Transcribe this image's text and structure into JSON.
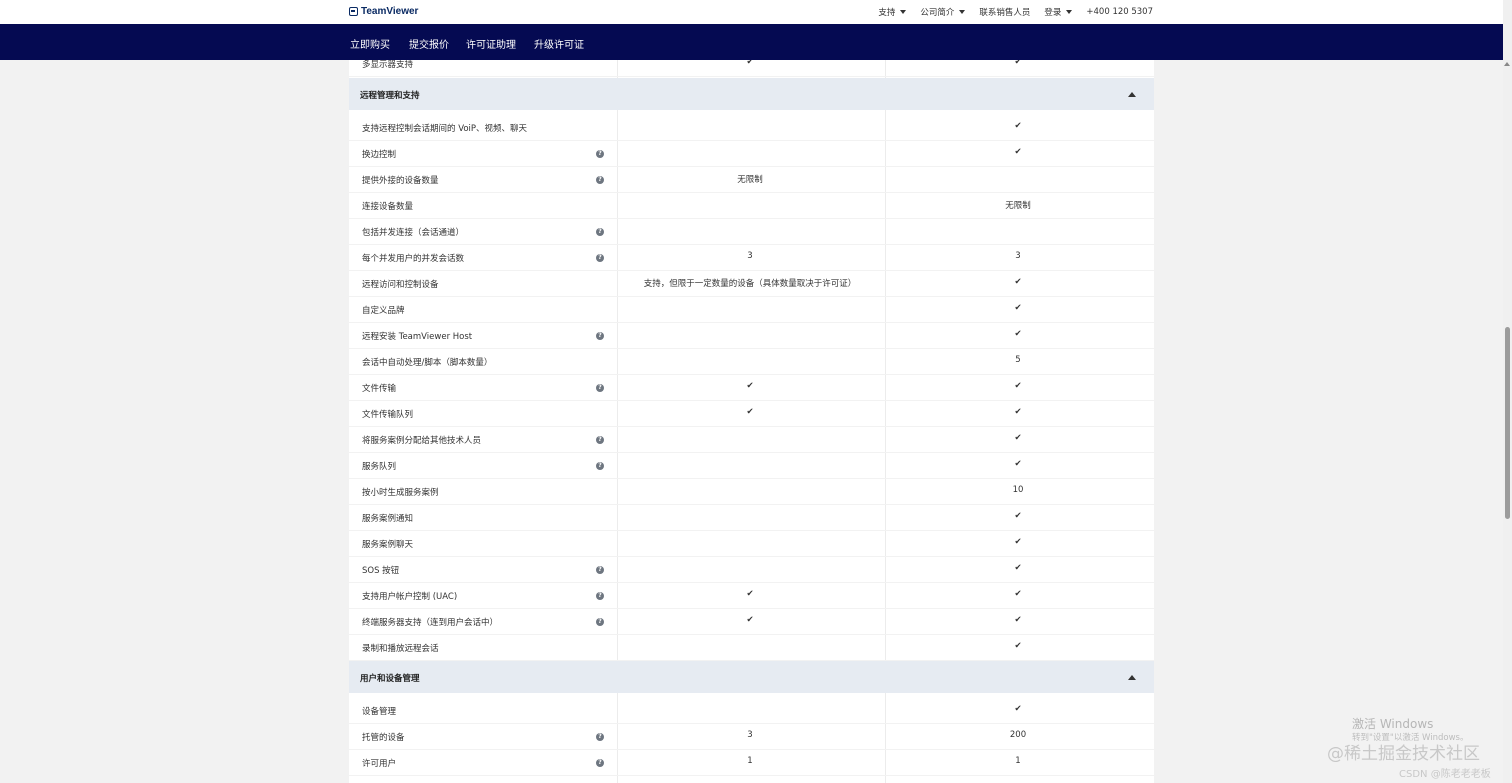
{
  "logo": {
    "text": "TeamViewer"
  },
  "topnav": {
    "support": "支持",
    "about": "公司简介",
    "contact_sales": "联系销售人员",
    "login": "登录",
    "phone": "+400 120 5307"
  },
  "navbar": {
    "buy": "立即购买",
    "quote": "提交报价",
    "license_help": "许可证助理",
    "upgrade": "升级许可证"
  },
  "table": {
    "sections": [
      {
        "title": "远程管理和支持"
      },
      {
        "title": "用户和设备管理"
      }
    ],
    "rows": [
      {
        "label": "多显示器支持",
        "help": false,
        "c1": "✔",
        "c2": "✔"
      },
      {
        "label": "支持远程控制会话期间的 VoiP、视频、聊天",
        "help": false,
        "c1": "",
        "c2": "✔"
      },
      {
        "label": "换边控制",
        "help": true,
        "c1": "",
        "c2": "✔"
      },
      {
        "label": "提供外接的设备数量",
        "help": true,
        "c1": "无限制",
        "c2": ""
      },
      {
        "label": "连接设备数量",
        "help": false,
        "c1": "",
        "c2": "无限制"
      },
      {
        "label": "包括并发连接（会话通道）",
        "help": true,
        "c1": "",
        "c2": ""
      },
      {
        "label": "每个并发用户的并发会话数",
        "help": true,
        "c1": "3",
        "c2": "3"
      },
      {
        "label": "远程访问和控制设备",
        "help": false,
        "c1": "支持，但限于一定数量的设备（具体数量取决于许可证）",
        "c2": "✔"
      },
      {
        "label": "自定义品牌",
        "help": false,
        "c1": "",
        "c2": "✔"
      },
      {
        "label": "远程安装 TeamViewer Host",
        "help": true,
        "c1": "",
        "c2": "✔"
      },
      {
        "label": "会话中自动处理/脚本（脚本数量）",
        "help": false,
        "c1": "",
        "c2": "5"
      },
      {
        "label": "文件传输",
        "help": true,
        "c1": "✔",
        "c2": "✔"
      },
      {
        "label": "文件传输队列",
        "help": false,
        "c1": "✔",
        "c2": "✔"
      },
      {
        "label": "将服务案例分配给其他技术人员",
        "help": true,
        "c1": "",
        "c2": "✔"
      },
      {
        "label": "服务队列",
        "help": true,
        "c1": "",
        "c2": "✔"
      },
      {
        "label": "按小时生成服务案例",
        "help": false,
        "c1": "",
        "c2": "10"
      },
      {
        "label": "服务案例通知",
        "help": false,
        "c1": "",
        "c2": "✔"
      },
      {
        "label": "服务案例聊天",
        "help": false,
        "c1": "",
        "c2": "✔"
      },
      {
        "label": "SOS 按钮",
        "help": true,
        "c1": "",
        "c2": "✔"
      },
      {
        "label": "支持用户帐户控制 (UAC)",
        "help": true,
        "c1": "✔",
        "c2": "✔"
      },
      {
        "label": "终端服务器支持（连到用户会话中）",
        "help": true,
        "c1": "✔",
        "c2": "✔"
      },
      {
        "label": "录制和播放远程会话",
        "help": false,
        "c1": "",
        "c2": "✔"
      },
      {
        "label": "设备管理",
        "help": false,
        "c1": "",
        "c2": "✔"
      },
      {
        "label": "托管的设备",
        "help": true,
        "c1": "3",
        "c2": "200"
      },
      {
        "label": "许可用户",
        "help": true,
        "c1": "1",
        "c2": "1"
      }
    ]
  },
  "watermark": {
    "activate": "激活 Windows",
    "activate_sub": "转到\"设置\"以激活 Windows。",
    "community": "@稀土掘金技术社区",
    "csdn": "CSDN @陈老老老板"
  },
  "colors": {
    "nav_bg": "#050a52",
    "section_bg": "#e6ebf2",
    "logo": "#0a2a63"
  }
}
